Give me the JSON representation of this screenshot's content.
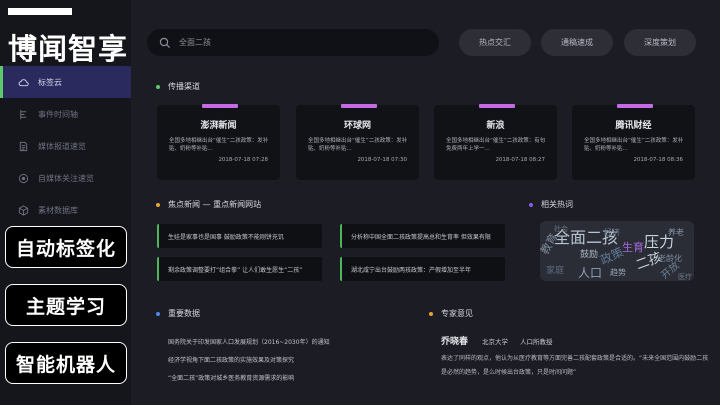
{
  "brand": {
    "title": "博闻智享"
  },
  "nav": [
    {
      "label": "标签云",
      "icon": "cloud-icon",
      "active": true
    },
    {
      "label": "事件时间轴",
      "icon": "timeline-icon",
      "active": false
    },
    {
      "label": "媒体报道速览",
      "icon": "document-icon",
      "active": false
    },
    {
      "label": "自媒体关注速览",
      "icon": "target-icon",
      "active": false
    },
    {
      "label": "素材数据库",
      "icon": "cube-icon",
      "active": false
    }
  ],
  "overlay_buttons": [
    "自动标签化",
    "主题学习",
    "智能机器人"
  ],
  "search": {
    "placeholder": "全面二孩"
  },
  "header_buttons": [
    "热点交汇",
    "通稿速成",
    "深度策划"
  ],
  "channels": {
    "title": "传播渠道",
    "cards": [
      {
        "name": "澎湃新闻",
        "desc": "全国多地相继出台“催生”二孩政策：发补贴、奶粉等补贴...",
        "time": "2018-07-18 07:28"
      },
      {
        "name": "环球网",
        "desc": "全国多地相继出台“催生”二孩政策：发补贴、奶粉等补贴...",
        "time": "2018-07-18 07:30"
      },
      {
        "name": "新浪",
        "desc": "全国多地相继出台“催生”二孩政策：有句免费两年上学一...",
        "time": "2018-07-18 08:27"
      },
      {
        "name": "腾讯财经",
        "desc": "全国多地相继出台“催生”二孩政策：发补贴、奶粉等补贴...",
        "time": "2018-07-18 08:36"
      }
    ]
  },
  "focus_news": {
    "title": "焦点新闻 — 重点新闻网站",
    "items": [
      "生娃是家事也是国事 鼓励政策不能刚饼充饥",
      "分析称中国全面二孩政策提高总和生育率 但效果有限",
      "剩余政策调整要打“组合拳” 让人们敢生愿生“二孩”",
      "湖北咸宁出台鼓励两孩政策：产假增加至半年"
    ]
  },
  "hot_words": {
    "title": "相关热词",
    "words": [
      "教育",
      "全面二孩",
      "政策",
      "生育",
      "压力",
      "人口",
      "开放",
      "二孩",
      "家庭",
      "养老",
      "经济",
      "趋势",
      "老龄化",
      "鼓励",
      "医疗",
      "社会"
    ]
  },
  "key_data": {
    "title": "重要数据",
    "items": [
      "国务院关于印发国家人口发展规划（2016~2030年）的通知",
      "经济学视角下面二孩政策的实施效果及对策探究",
      "“全面二孩”政策对城乡医务教育资源需求的影响"
    ]
  },
  "expert": {
    "title": "专家意见",
    "name": "乔晓春",
    "org": "北京大学",
    "dept": "人口所教授",
    "opinion": "表达了同样的观点，他认为从医疗教育等方面完善二孩配套政策是合适的。“未来全国范围内鼓励二孩是必然的趋势，是么时候出台政策，只是时间问题”"
  },
  "colors": {
    "accent_green": "#5dc96b",
    "active_nav": "#2b2a5e",
    "card_tab": "#c36be3",
    "dot_blue": "#4f86e8",
    "dot_orange": "#e8a23a",
    "dot_purple": "#8a5be8"
  }
}
